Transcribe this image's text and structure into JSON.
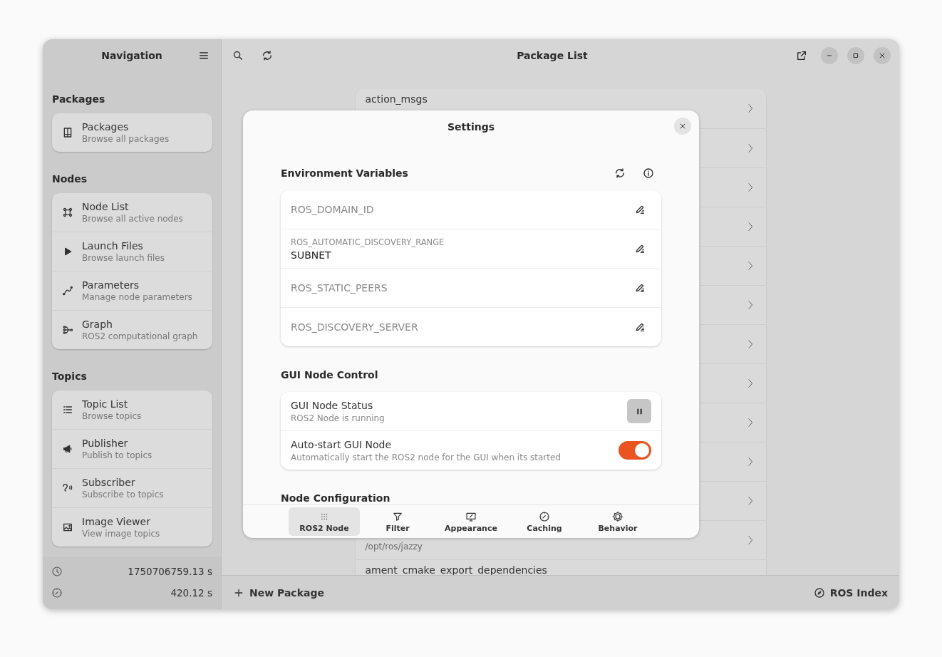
{
  "sidebar": {
    "title": "Navigation",
    "sections": [
      {
        "heading": "Packages",
        "items": [
          {
            "kind": "book",
            "title": "Packages",
            "subtitle": "Browse all packages"
          }
        ]
      },
      {
        "heading": "Nodes",
        "items": [
          {
            "kind": "nodes",
            "title": "Node List",
            "subtitle": "Browse all active nodes"
          },
          {
            "kind": "play",
            "title": "Launch Files",
            "subtitle": "Browse launch files"
          },
          {
            "kind": "curve",
            "title": "Parameters",
            "subtitle": "Manage node parameters"
          },
          {
            "kind": "graph",
            "title": "Graph",
            "subtitle": "ROS2 computational graph"
          }
        ]
      },
      {
        "heading": "Topics",
        "items": [
          {
            "kind": "list",
            "title": "Topic List",
            "subtitle": "Browse topics"
          },
          {
            "kind": "megaphone",
            "title": "Publisher",
            "subtitle": "Publish to topics"
          },
          {
            "kind": "ear",
            "title": "Subscriber",
            "subtitle": "Subscribe to topics"
          },
          {
            "kind": "image",
            "title": "Image Viewer",
            "subtitle": "View image topics"
          }
        ]
      }
    ],
    "status": [
      {
        "kind": "clock",
        "value": "1750706759.13 s"
      },
      {
        "kind": "gauge",
        "value": "420.12 s"
      }
    ]
  },
  "main": {
    "title": "Package List",
    "packages": [
      {
        "title": "action_msgs",
        "chevron": true
      },
      {
        "chevron": true
      },
      {
        "chevron": true
      },
      {
        "chevron": true
      },
      {
        "chevron": true
      },
      {
        "chevron": true
      },
      {
        "chevron": true
      },
      {
        "chevron": true
      },
      {
        "chevron": true
      },
      {
        "chevron": true
      },
      {
        "chevron": true
      },
      {
        "subtitle": "/opt/ros/jazzy",
        "chevron": true
      },
      {
        "title": "ament_cmake_export_dependencies"
      }
    ],
    "new_button": "New Package",
    "index_link": "ROS Index"
  },
  "settings": {
    "title": "Settings",
    "env_heading": "Environment Variables",
    "env_vars": [
      {
        "name": "ROS_DOMAIN_ID"
      },
      {
        "name": "ROS_AUTOMATIC_DISCOVERY_RANGE",
        "value": "SUBNET"
      },
      {
        "name": "ROS_STATIC_PEERS"
      },
      {
        "name": "ROS_DISCOVERY_SERVER"
      }
    ],
    "control_heading": "GUI Node Control",
    "node_status": {
      "title": "GUI Node Status",
      "subtitle": "ROS2 Node is running",
      "running": true
    },
    "auto_start": {
      "title": "Auto-start GUI Node",
      "subtitle": "Automatically start the ROS2 node for the GUI when its started",
      "on": true
    },
    "config_heading": "Node Configuration",
    "tabs": [
      {
        "kind": "grid",
        "label": "ROS2 Node",
        "selected": true
      },
      {
        "kind": "filter",
        "label": "Filter",
        "selected": false
      },
      {
        "kind": "monitor",
        "label": "Appearance",
        "selected": false
      },
      {
        "kind": "gauge",
        "label": "Caching",
        "selected": false
      },
      {
        "kind": "gear",
        "label": "Behavior",
        "selected": false
      }
    ]
  }
}
